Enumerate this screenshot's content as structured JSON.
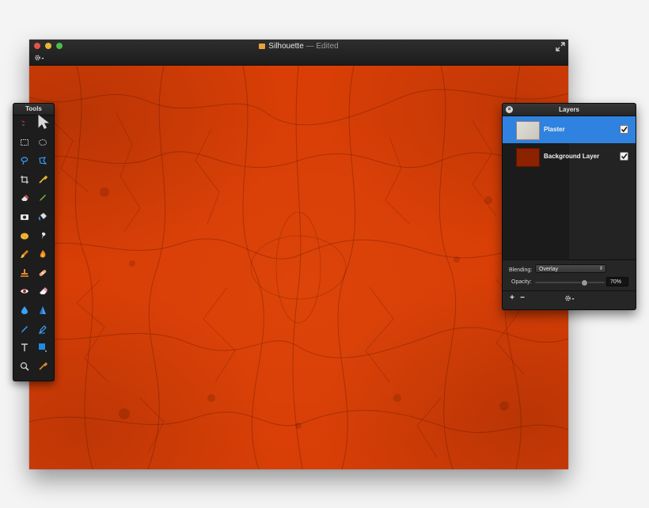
{
  "window": {
    "title": "Silhouette",
    "edited_label": "— Edited"
  },
  "tools": {
    "title": "Tools",
    "items": [
      {
        "name": "arrange-tool-icon",
        "glyph": "arrange"
      },
      {
        "name": "move-tool-icon",
        "glyph": "move"
      },
      {
        "name": "rect-select-tool-icon",
        "glyph": "rect"
      },
      {
        "name": "ellipse-select-tool-icon",
        "glyph": "ellipse"
      },
      {
        "name": "lasso-tool-icon",
        "glyph": "lasso"
      },
      {
        "name": "polygon-lasso-tool-icon",
        "glyph": "poly"
      },
      {
        "name": "crop-tool-icon",
        "glyph": "crop"
      },
      {
        "name": "eyedropper-tool-icon",
        "glyph": "eyedropper"
      },
      {
        "name": "eraser-wand-tool-icon",
        "glyph": "eraser2"
      },
      {
        "name": "pencil-tool-icon",
        "glyph": "pencil"
      },
      {
        "name": "magic-wand-tool-icon",
        "glyph": "mask"
      },
      {
        "name": "paint-bucket-tool-icon",
        "glyph": "bucket"
      },
      {
        "name": "sponge-tool-icon",
        "glyph": "sponge"
      },
      {
        "name": "smudge-tool-icon",
        "glyph": "smudge"
      },
      {
        "name": "brush-tool-icon",
        "glyph": "brush"
      },
      {
        "name": "burn-tool-icon",
        "glyph": "burn"
      },
      {
        "name": "clone-stamp-tool-icon",
        "glyph": "stamp"
      },
      {
        "name": "bandage-tool-icon",
        "glyph": "bandage"
      },
      {
        "name": "red-eye-tool-icon",
        "glyph": "eye"
      },
      {
        "name": "eraser-tool-icon",
        "glyph": "eraser"
      },
      {
        "name": "blur-tool-icon",
        "glyph": "drop"
      },
      {
        "name": "sharpen-tool-icon",
        "glyph": "cone"
      },
      {
        "name": "pen-tool-icon",
        "glyph": "pen"
      },
      {
        "name": "vector-pen-tool-icon",
        "glyph": "vpen"
      },
      {
        "name": "text-tool-icon",
        "glyph": "text"
      },
      {
        "name": "shape-tool-icon",
        "glyph": "shape"
      },
      {
        "name": "zoom-tool-icon",
        "glyph": "zoom"
      },
      {
        "name": "color-picker-tool-icon",
        "glyph": "picker"
      }
    ]
  },
  "layers": {
    "title": "Layers",
    "items": [
      {
        "name": "Plaster",
        "selected": true,
        "visible": true,
        "thumb_color": "#d6d3cd"
      },
      {
        "name": "Background Layer",
        "selected": false,
        "visible": true,
        "thumb_color": "#8c2200"
      }
    ],
    "blending_label": "Blending:",
    "blending_value": "Overlay",
    "opacity_label": "Opacity:",
    "opacity_value": "70%",
    "opacity_fraction": 0.7,
    "add_label": "+",
    "remove_label": "−",
    "settings_icon": "gear-icon"
  },
  "colors": {
    "canvas": "#d83e06",
    "selection_blue": "#2f82e0"
  }
}
